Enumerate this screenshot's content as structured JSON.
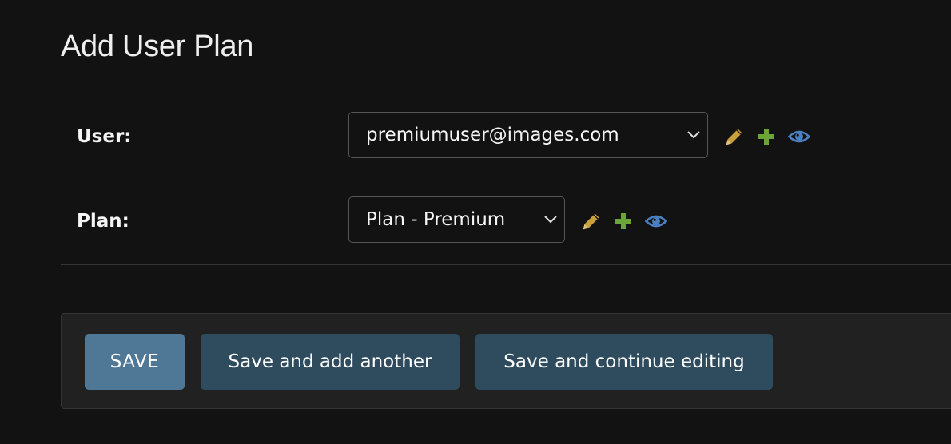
{
  "page": {
    "title": "Add User Plan"
  },
  "form": {
    "user": {
      "label": "User:",
      "selected": "premiumuser@images.com"
    },
    "plan": {
      "label": "Plan:",
      "selected": "Plan - Premium"
    },
    "related_action_icons": [
      "pencil-icon",
      "plus-icon",
      "eye-icon"
    ]
  },
  "submit": {
    "save_label": "SAVE",
    "save_add_another_label": "Save and add another",
    "save_continue_label": "Save and continue editing"
  },
  "colors": {
    "background": "#121212",
    "submit_row_bg": "#212121",
    "primary_button": "#4f7896",
    "secondary_button": "#2f4b5e",
    "edit_icon": "#c9a03a",
    "add_icon": "#6ba539",
    "view_icon": "#4a7fc1"
  }
}
